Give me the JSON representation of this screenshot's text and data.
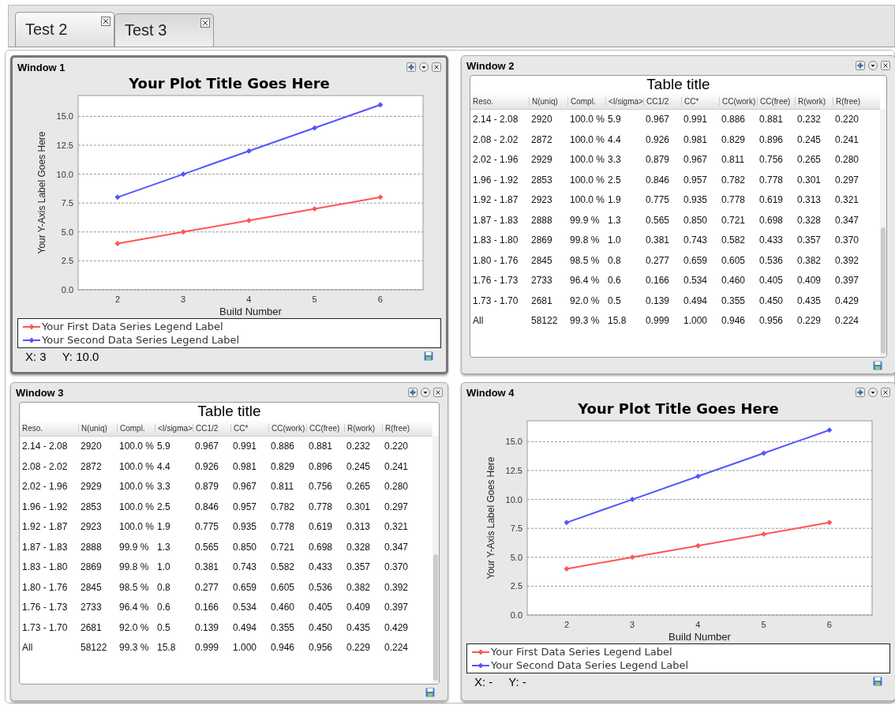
{
  "tabs": [
    {
      "label": "Test 2",
      "selected": true
    },
    {
      "label": "Test 3",
      "selected": false
    }
  ],
  "windows": [
    {
      "title": "Window 1",
      "kind": "chart",
      "active": true,
      "chart_data": {
        "type": "line",
        "title": "Your Plot Title Goes Here",
        "xlabel": "Build Number",
        "ylabel": "Your Y-Axis Label Goes Here",
        "grid": true,
        "x": [
          2,
          3,
          4,
          5,
          6
        ],
        "xlim": [
          1.4,
          6.65
        ],
        "ylim": [
          0,
          16.8
        ],
        "xticks": [
          2,
          3,
          4,
          5,
          6
        ],
        "yticks": [
          {
            "value": 0,
            "label": "0.0"
          },
          {
            "value": 2.5,
            "label": "2.5"
          },
          {
            "value": 5,
            "label": "5.0"
          },
          {
            "value": 7.5,
            "label": "7.5"
          },
          {
            "value": 10,
            "label": "10.0"
          },
          {
            "value": 12.5,
            "label": "12.5"
          },
          {
            "value": 15,
            "label": "15.0"
          }
        ],
        "series": [
          {
            "name": "Your First Data Series Legend Label",
            "color": "#ff5555",
            "marker": "diamond",
            "values": [
              4,
              5,
              6,
              7,
              8
            ]
          },
          {
            "name": "Your Second Data Series Legend Label",
            "color": "#5555ff",
            "marker": "diamond",
            "values": [
              8,
              10,
              12,
              14,
              16
            ]
          }
        ]
      },
      "status": {
        "x": "X: 3",
        "y": "Y: 10.0"
      }
    },
    {
      "title": "Window 2",
      "kind": "table",
      "active": false,
      "table": {
        "title": "Table title",
        "columns": [
          "Reso.",
          "N(uniq)",
          "Compl.",
          "<I/sigma>",
          "CC1/2",
          "CC*",
          "CC(work)",
          "CC(free)",
          "R(work)",
          "R(free)"
        ],
        "rows": [
          [
            "2.14 - 2.08",
            "2920",
            "100.0 %",
            "5.9",
            "0.967",
            "0.991",
            "0.886",
            "0.881",
            "0.232",
            "0.220"
          ],
          [
            "2.08 - 2.02",
            "2872",
            "100.0 %",
            "4.4",
            "0.926",
            "0.981",
            "0.829",
            "0.896",
            "0.245",
            "0.241"
          ],
          [
            "2.02 - 1.96",
            "2929",
            "100.0 %",
            "3.3",
            "0.879",
            "0.967",
            "0.811",
            "0.756",
            "0.265",
            "0.280"
          ],
          [
            "1.96 - 1.92",
            "2853",
            "100.0 %",
            "2.5",
            "0.846",
            "0.957",
            "0.782",
            "0.778",
            "0.301",
            "0.297"
          ],
          [
            "1.92 - 1.87",
            "2923",
            "100.0 %",
            "1.9",
            "0.775",
            "0.935",
            "0.778",
            "0.619",
            "0.313",
            "0.321"
          ],
          [
            "1.87 - 1.83",
            "2888",
            "99.9 %",
            "1.3",
            "0.565",
            "0.850",
            "0.721",
            "0.698",
            "0.328",
            "0.347"
          ],
          [
            "1.83 - 1.80",
            "2869",
            "99.8 %",
            "1.0",
            "0.381",
            "0.743",
            "0.582",
            "0.433",
            "0.357",
            "0.370"
          ],
          [
            "1.80 - 1.76",
            "2845",
            "98.5 %",
            "0.8",
            "0.277",
            "0.659",
            "0.605",
            "0.536",
            "0.382",
            "0.392"
          ],
          [
            "1.76 - 1.73",
            "2733",
            "96.4 %",
            "0.6",
            "0.166",
            "0.534",
            "0.460",
            "0.405",
            "0.409",
            "0.397"
          ],
          [
            "1.73 - 1.70",
            "2681",
            "92.0 %",
            "0.5",
            "0.139",
            "0.494",
            "0.355",
            "0.450",
            "0.435",
            "0.429"
          ],
          [
            "All",
            "58122",
            "99.3 %",
            "15.8",
            "0.999",
            "1.000",
            "0.946",
            "0.956",
            "0.229",
            "0.224"
          ]
        ]
      }
    },
    {
      "title": "Window 3",
      "kind": "table",
      "active": false,
      "table": {
        "title": "Table title",
        "columns": [
          "Reso.",
          "N(uniq)",
          "Compl.",
          "<I/sigma>",
          "CC1/2",
          "CC*",
          "CC(work)",
          "CC(free)",
          "R(work)",
          "R(free)"
        ],
        "rows": [
          [
            "2.14 - 2.08",
            "2920",
            "100.0 %",
            "5.9",
            "0.967",
            "0.991",
            "0.886",
            "0.881",
            "0.232",
            "0.220"
          ],
          [
            "2.08 - 2.02",
            "2872",
            "100.0 %",
            "4.4",
            "0.926",
            "0.981",
            "0.829",
            "0.896",
            "0.245",
            "0.241"
          ],
          [
            "2.02 - 1.96",
            "2929",
            "100.0 %",
            "3.3",
            "0.879",
            "0.967",
            "0.811",
            "0.756",
            "0.265",
            "0.280"
          ],
          [
            "1.96 - 1.92",
            "2853",
            "100.0 %",
            "2.5",
            "0.846",
            "0.957",
            "0.782",
            "0.778",
            "0.301",
            "0.297"
          ],
          [
            "1.92 - 1.87",
            "2923",
            "100.0 %",
            "1.9",
            "0.775",
            "0.935",
            "0.778",
            "0.619",
            "0.313",
            "0.321"
          ],
          [
            "1.87 - 1.83",
            "2888",
            "99.9 %",
            "1.3",
            "0.565",
            "0.850",
            "0.721",
            "0.698",
            "0.328",
            "0.347"
          ],
          [
            "1.83 - 1.80",
            "2869",
            "99.8 %",
            "1.0",
            "0.381",
            "0.743",
            "0.582",
            "0.433",
            "0.357",
            "0.370"
          ],
          [
            "1.80 - 1.76",
            "2845",
            "98.5 %",
            "0.8",
            "0.277",
            "0.659",
            "0.605",
            "0.536",
            "0.382",
            "0.392"
          ],
          [
            "1.76 - 1.73",
            "2733",
            "96.4 %",
            "0.6",
            "0.166",
            "0.534",
            "0.460",
            "0.405",
            "0.409",
            "0.397"
          ],
          [
            "1.73 - 1.70",
            "2681",
            "92.0 %",
            "0.5",
            "0.139",
            "0.494",
            "0.355",
            "0.450",
            "0.435",
            "0.429"
          ],
          [
            "All",
            "58122",
            "99.3 %",
            "15.8",
            "0.999",
            "1.000",
            "0.946",
            "0.956",
            "0.229",
            "0.224"
          ]
        ]
      }
    },
    {
      "title": "Window 4",
      "kind": "chart",
      "active": false,
      "chart_data": {
        "type": "line",
        "title": "Your Plot Title Goes Here",
        "xlabel": "Build Number",
        "ylabel": "Your Y-Axis Label Goes Here",
        "grid": true,
        "x": [
          2,
          3,
          4,
          5,
          6
        ],
        "xlim": [
          1.4,
          6.65
        ],
        "ylim": [
          0,
          16.8
        ],
        "xticks": [
          2,
          3,
          4,
          5,
          6
        ],
        "yticks": [
          {
            "value": 0,
            "label": "0.0"
          },
          {
            "value": 2.5,
            "label": "2.5"
          },
          {
            "value": 5,
            "label": "5.0"
          },
          {
            "value": 7.5,
            "label": "7.5"
          },
          {
            "value": 10,
            "label": "10.0"
          },
          {
            "value": 12.5,
            "label": "12.5"
          },
          {
            "value": 15,
            "label": "15.0"
          }
        ],
        "series": [
          {
            "name": "Your First Data Series Legend Label",
            "color": "#ff5555",
            "marker": "diamond",
            "values": [
              4,
              5,
              6,
              7,
              8
            ]
          },
          {
            "name": "Your Second Data Series Legend Label",
            "color": "#5555ff",
            "marker": "diamond",
            "values": [
              8,
              10,
              12,
              14,
              16
            ]
          }
        ]
      },
      "status": {
        "x": "X: -",
        "y": "Y: -"
      }
    }
  ]
}
